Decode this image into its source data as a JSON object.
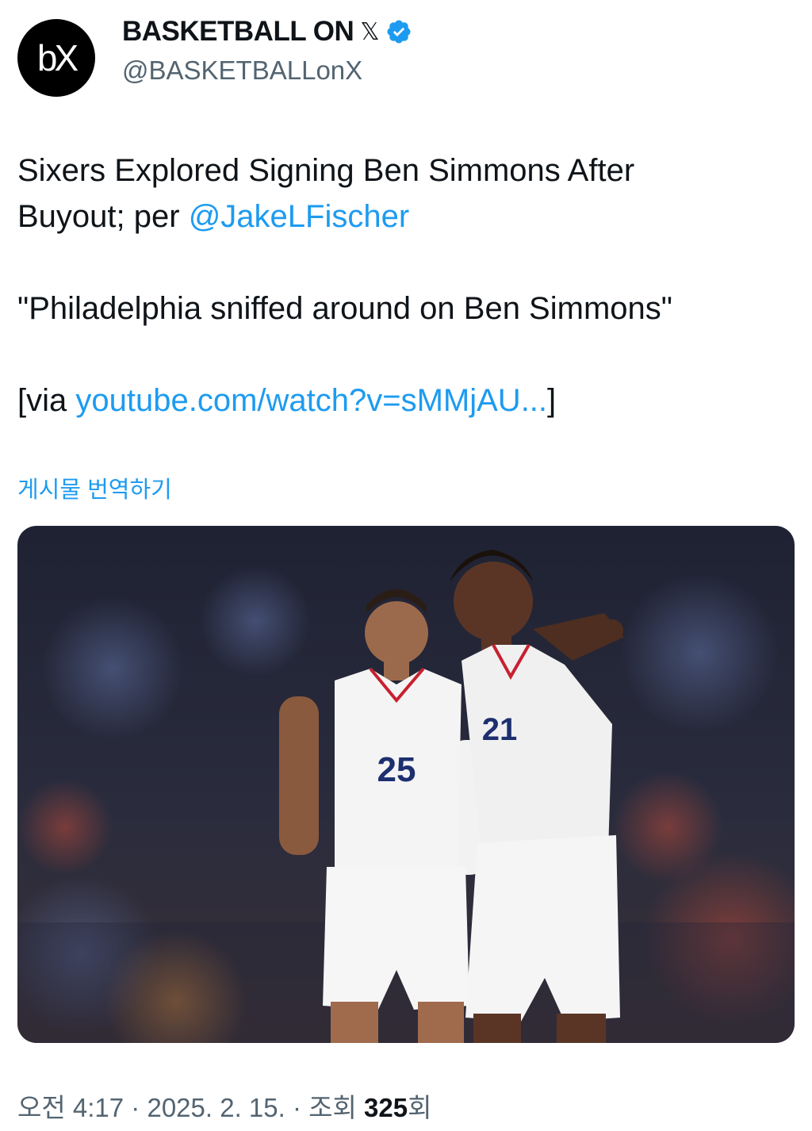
{
  "account": {
    "avatar_text": "bX",
    "display_name": "BASKETBALL ON",
    "handle": "@BASKETBALLonX"
  },
  "tweet": {
    "line1_text": "Sixers Explored Signing Ben Simmons After",
    "line2_text": "Buyout; per ",
    "mention": "@JakeLFischer",
    "quote": "\"Philadelphia sniffed around on Ben Simmons\"",
    "via_prefix": "[via ",
    "via_link": "youtube.com/watch?v=sMMjAU...",
    "via_suffix": "]"
  },
  "translate_label": "게시물 번역하기",
  "media": {
    "jersey_left": "25",
    "jersey_right": "21"
  },
  "meta": {
    "time": "오전 4:17",
    "date": "2025. 2. 15.",
    "views_prefix": "조회 ",
    "views_count": "325",
    "views_suffix": "회"
  },
  "colors": {
    "link": "#1d9bf0",
    "secondary_text": "#536471",
    "verified_badge": "#1d9bf0"
  }
}
